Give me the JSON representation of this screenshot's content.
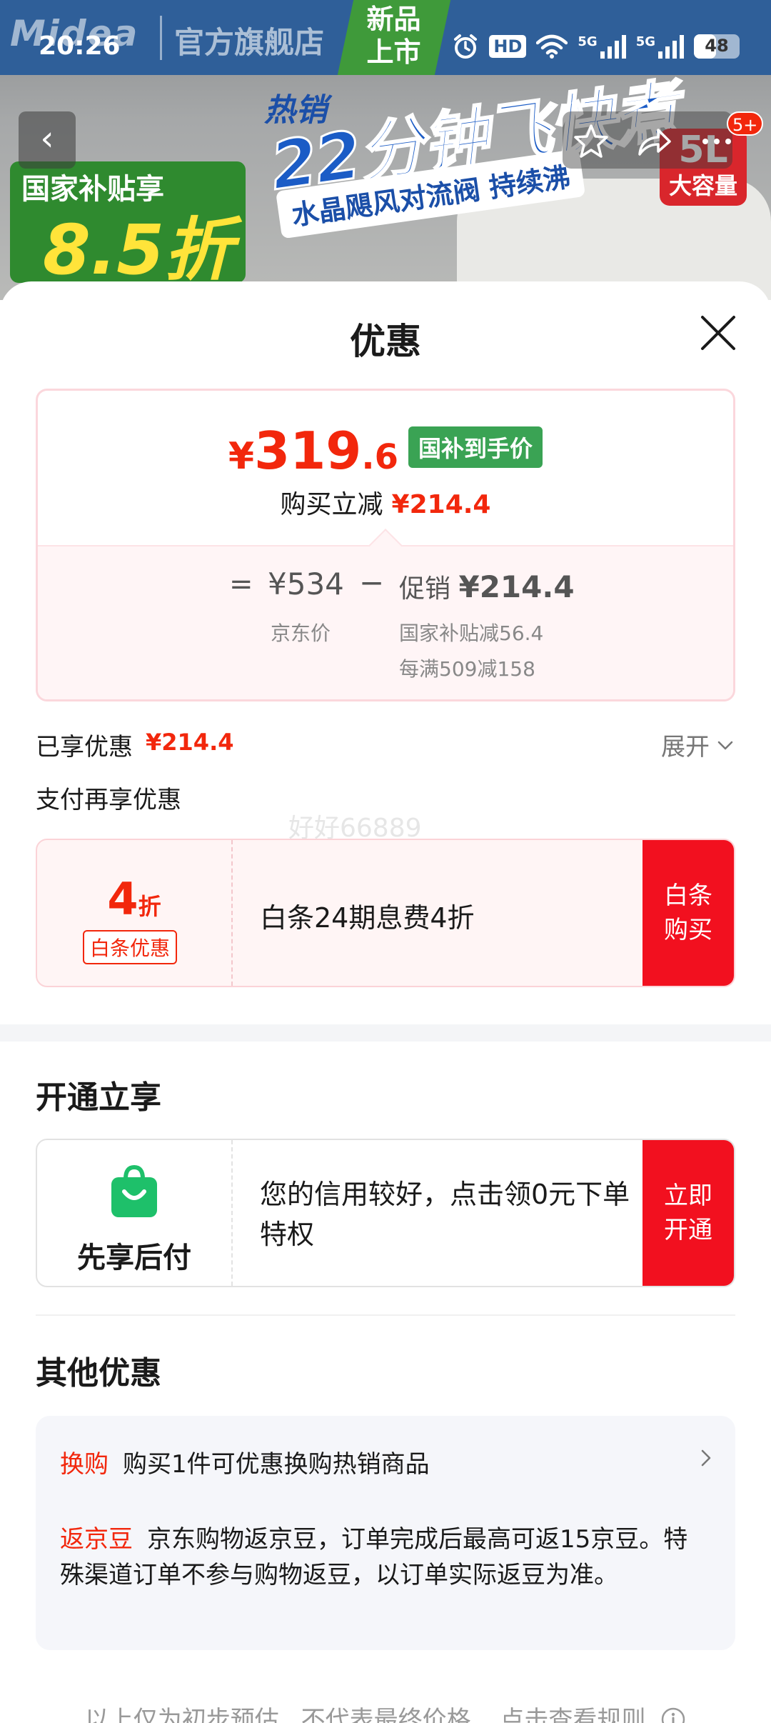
{
  "banner": {
    "brand_logo": "Midea",
    "store_name": "官方旗舰店",
    "new_badge": "新品上市",
    "slogan": "热销",
    "headline": "22分钟飞快煮",
    "subline": "水晶飓风对流阀 持续沸",
    "subsidy_title": "国家补贴享",
    "subsidy_value": "8.5折",
    "capacity_big": "5L",
    "capacity_small": "大容量"
  },
  "status_bar": {
    "time": "20:26",
    "hd_label": "HD",
    "network_1": "5G",
    "network_2": "5G",
    "battery_level": "48",
    "battery_fraction": 0.48
  },
  "nav": {
    "back_glyph": "‹",
    "message_badge": "5+"
  },
  "sheet": {
    "title": "优惠",
    "price_card": {
      "currency": "¥",
      "price_int": "319",
      "price_dec": ".6",
      "price_tag": "国补到手价",
      "saving_label": "购买立减",
      "saving_value": "¥214.4",
      "eq": "=",
      "orig_price": "¥534",
      "minus": "−",
      "promo_label": "促销",
      "promo_value": "¥214.4",
      "orig_label": "京东价",
      "detail_1": "国家补贴减56.4",
      "detail_2": "每满509减158"
    },
    "enjoyed_label": "已享优惠",
    "enjoyed_value": "¥214.4",
    "expand_label": "展开",
    "pay_more_title": "支付再享优惠",
    "watermark": "好好66889",
    "baitiao": {
      "discount_big": "4",
      "discount_small": "折",
      "tag": "白条优惠",
      "text": "白条24期息费4折",
      "action": "白条购买"
    },
    "open_section_title": "开通立享",
    "paylater": {
      "label": "先享后付",
      "text": "您的信用较好，点击领0元下单特权",
      "action": "立即开通"
    },
    "other_section_title": "其他优惠",
    "other_items": [
      {
        "tag": "换购",
        "text": "购买1件可优惠换购热销商品"
      },
      {
        "tag": "返京豆",
        "text": "京东购物返京豆，订单完成后最高可返15京豆。特殊渠道订单不参与购物返豆，以订单实际返豆为准。"
      }
    ],
    "footer_note_1": "以上仅为初步预估",
    "footer_note_2": "不代表最终价格",
    "footer_note_3": "点击查看规则"
  },
  "colors": {
    "accent_red": "#f2270c",
    "button_red": "#f2101f",
    "tag_green": "#3aa354",
    "paylater_green": "#1ec06a"
  }
}
